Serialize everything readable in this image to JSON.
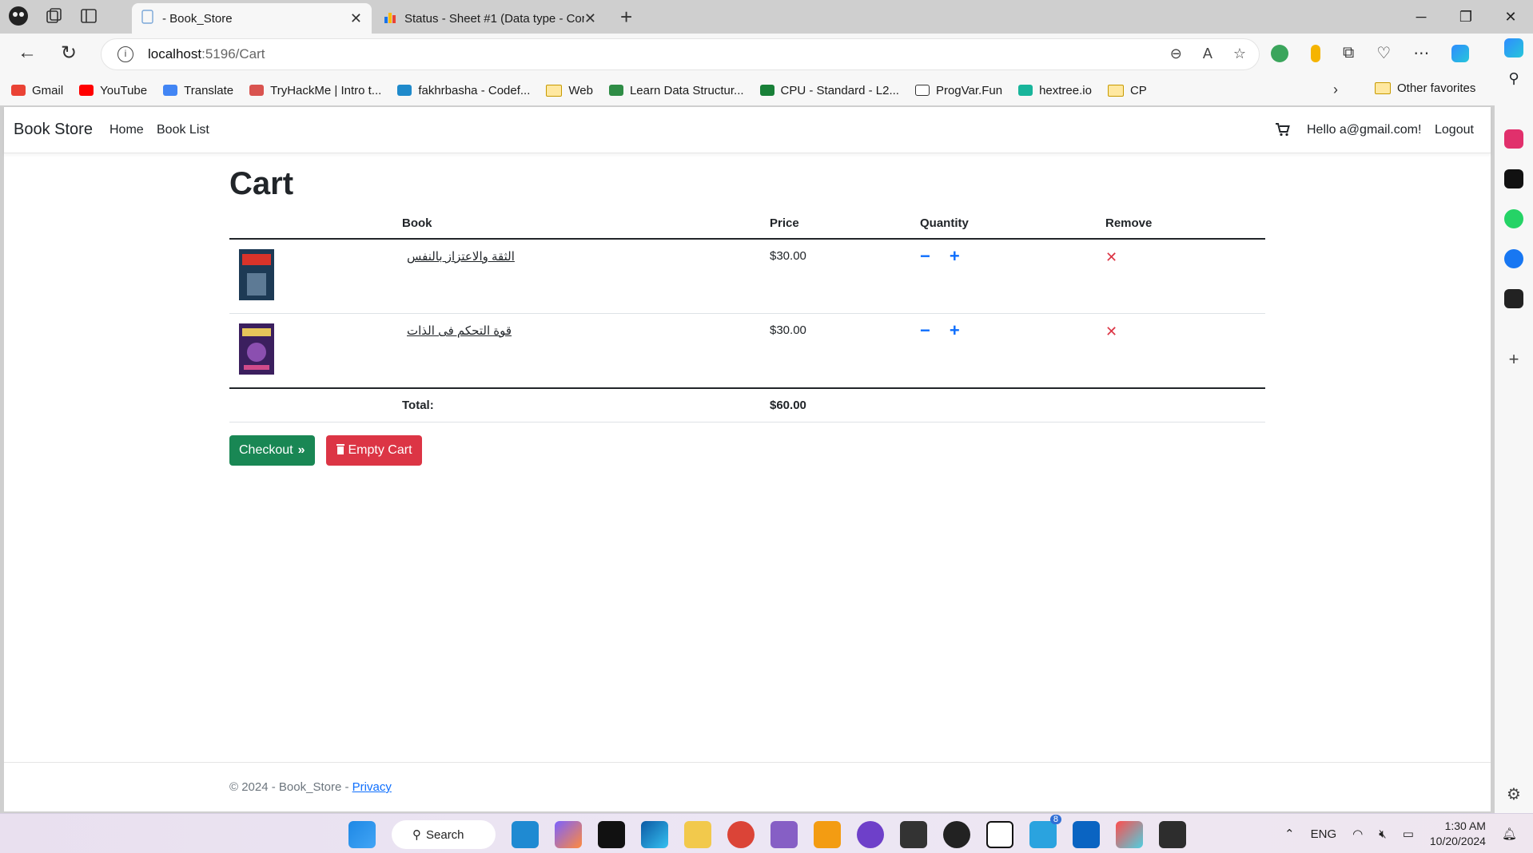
{
  "browser": {
    "tabs": [
      {
        "title": "- Book_Store",
        "active": true
      },
      {
        "title": "Status - Sheet #1 (Data type - Cor",
        "active": false
      }
    ],
    "url_host": "localhost",
    "url_path": ":5196/Cart",
    "bookmarks": [
      "Gmail",
      "YouTube",
      "Translate",
      "TryHackMe | Intro t...",
      "fakhrbasha - Codef...",
      "Web",
      "Learn Data Structur...",
      "CPU - Standard - L2...",
      "ProgVar.Fun",
      "hextree.io",
      "CP"
    ],
    "other_favorites": "Other favorites"
  },
  "app": {
    "brand": "Book Store",
    "nav": {
      "home": "Home",
      "book_list": "Book List"
    },
    "greeting": "Hello a@gmail.com!",
    "logout": "Logout"
  },
  "cart": {
    "title": "Cart",
    "headers": {
      "book": "Book",
      "price": "Price",
      "quantity": "Quantity",
      "remove": "Remove"
    },
    "items": [
      {
        "name": "الثقة والاعتزاز بالنفس",
        "price": "$30.00"
      },
      {
        "name": "قوة التحكم فى الذات",
        "price": "$30.00"
      }
    ],
    "total_label": "Total:",
    "total_value": "$60.00",
    "checkout_label": "Checkout",
    "empty_label": "Empty Cart",
    "qty_minus": "−",
    "qty_plus": "+",
    "remove_symbol": "✕"
  },
  "footer": {
    "text": "© 2024 - Book_Store - ",
    "privacy": "Privacy"
  },
  "taskbar": {
    "search": "Search",
    "lang": "ENG",
    "time": "1:30 AM",
    "date": "10/20/2024",
    "badge": "8"
  },
  "colors": {
    "success": "#198754",
    "danger": "#dc3545",
    "link": "#0d6efd"
  }
}
